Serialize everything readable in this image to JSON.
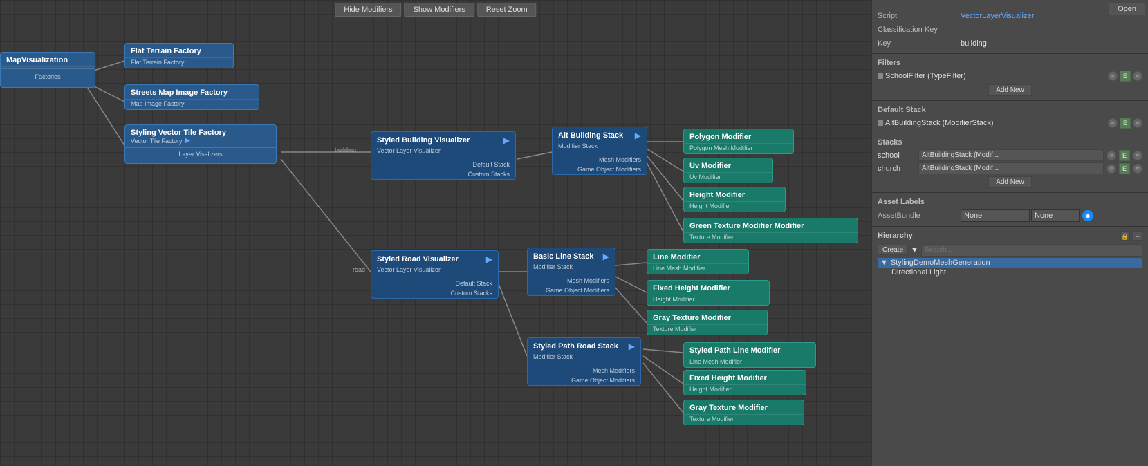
{
  "toolbar": {
    "hide_modifiers": "Hide Modifiers",
    "show_modifiers": "Show Modifiers",
    "reset_zoom": "Reset Zoom",
    "open": "Open"
  },
  "nodes": {
    "map_visualization": {
      "title": "MapVisualization",
      "label": "Factories"
    },
    "flat_terrain_factory": {
      "title": "Flat Terrain Factory",
      "subtitle": "Flat Terrain Factory"
    },
    "streets_map_image_factory": {
      "title": "Streets Map Image Factory",
      "subtitle": "Map Image Factory"
    },
    "styling_vector_tile_factory": {
      "title": "Styling Vector Tile Factory",
      "subtitle": "Vector Tile Factory",
      "label": "Layer Visalizers"
    },
    "styled_building_visualizer": {
      "title": "Styled Building Visualizer",
      "subtitle": "Vector Layer Visualizer",
      "port_in": "building",
      "row1": "Default Stack",
      "row2": "Custom Stacks"
    },
    "alt_building_stack": {
      "title": "Alt Building Stack",
      "subtitle": "Modifier Stack",
      "row1": "Mesh Modifiers",
      "row2": "Game Object Modifiers"
    },
    "polygon_modifier": {
      "title": "Polygon Modifier",
      "subtitle": "Polygon Mesh Modifier"
    },
    "uv_modifier": {
      "title": "Uv Modifier",
      "subtitle": "Uv Modifier"
    },
    "height_modifier": {
      "title": "Height Modifier",
      "subtitle": "Height Modifier"
    },
    "green_texture_modifier": {
      "title": "Green Texture Modifier Modifier",
      "subtitle": "Texture Modifier"
    },
    "styled_road_visualizer": {
      "title": "Styled Road Visualizer",
      "subtitle": "Vector Layer Visualizer",
      "port_in": "road",
      "row1": "Default Stack",
      "row2": "Custom Stacks"
    },
    "basic_line_stack": {
      "title": "Basic Line Stack",
      "subtitle": "Modifier Stack",
      "row1": "Mesh Modifiers",
      "row2": "Game Object Modifiers"
    },
    "line_modifier": {
      "title": "Line Modifier",
      "subtitle": "Line Mesh Modifier"
    },
    "fixed_height_modifier_road": {
      "title": "Fixed Height Modifier",
      "subtitle": "Height Modifier"
    },
    "gray_texture_modifier_road": {
      "title": "Gray Texture Modifier",
      "subtitle": "Texture Modifier"
    },
    "styled_path_road_stack": {
      "title": "Styled Path Road Stack",
      "subtitle": "Modifier Stack",
      "row1": "Mesh Modifiers",
      "row2": "Game Object Modifiers"
    },
    "styled_path_line_modifier": {
      "title": "Styled Path Line Modifier",
      "subtitle": "Line Mesh Modifier"
    },
    "fixed_height_modifier_path": {
      "title": "Fixed Height Modifier",
      "subtitle": "Height Modifier"
    },
    "gray_texture_modifier_path": {
      "title": "Gray Texture Modifier",
      "subtitle": "Texture Modifier"
    }
  },
  "right_panel": {
    "script_label": "Script",
    "script_value": "VectorLayerVisualizer",
    "classification_key_label": "Classification Key",
    "key_label": "Key",
    "key_value": "building",
    "filters_label": "Filters",
    "filter_item": "SchoolFilter (TypeFilter)",
    "add_new_label": "Add New",
    "default_stack_label": "Default Stack",
    "default_stack_value": "AltBuildingStack (ModifierStack)",
    "stacks_label": "Stacks",
    "stack_rows": [
      {
        "key": "school",
        "value": "AltBuildingStack (Modif..."
      },
      {
        "key": "church",
        "value": "AltBuildingStack (Modif..."
      }
    ],
    "stacks_add_new": "Add New",
    "asset_labels_label": "Asset Labels",
    "asset_bundle_label": "AssetBundle",
    "asset_bundle_value1": "None",
    "asset_bundle_value2": "None",
    "hierarchy_label": "Hierarchy",
    "create_label": "Create",
    "search_placeholder": "Search...",
    "hierarchy_item": "StylingDemoMeshGeneration",
    "hierarchy_sub": "Directional Light"
  }
}
